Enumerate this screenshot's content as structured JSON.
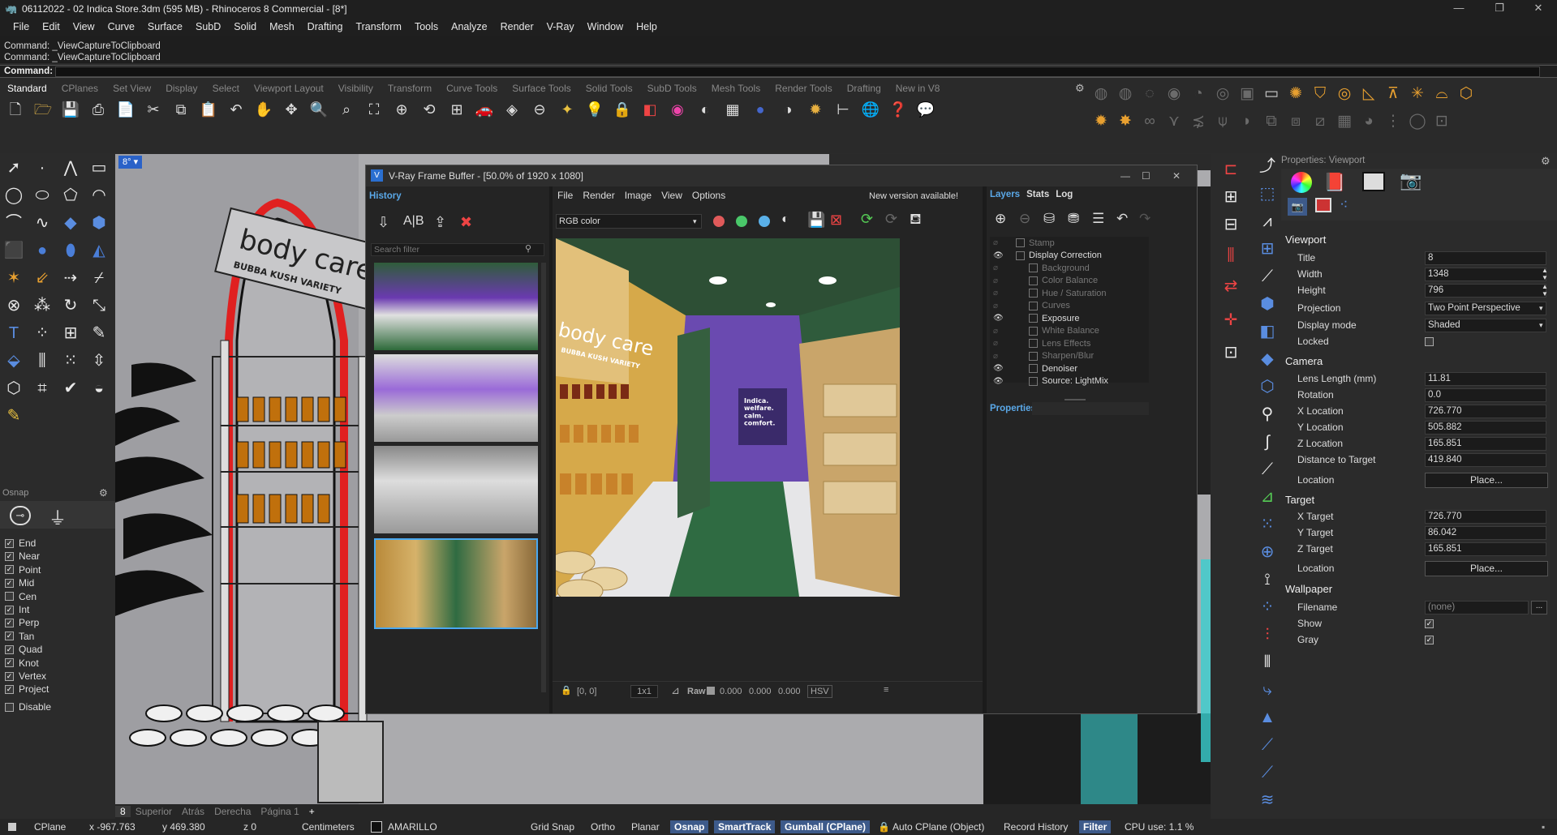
{
  "window": {
    "title": "06112022 - 02 Indica Store.3dm (595 MB) - Rhinoceros 8 Commercial - [8*]"
  },
  "menu": [
    "File",
    "Edit",
    "View",
    "Curve",
    "Surface",
    "SubD",
    "Solid",
    "Mesh",
    "Drafting",
    "Transform",
    "Tools",
    "Analyze",
    "Render",
    "V-Ray",
    "Window",
    "Help"
  ],
  "command_history": [
    "Command: _ViewCaptureToClipboard",
    "Command: _ViewCaptureToClipboard"
  ],
  "command_prompt": "Command:",
  "toolbar_tabs": [
    "Standard",
    "CPlanes",
    "Set View",
    "Display",
    "Select",
    "Viewport Layout",
    "Visibility",
    "Transform",
    "Curve Tools",
    "Surface Tools",
    "Solid Tools",
    "SubD Tools",
    "Mesh Tools",
    "Render Tools",
    "Drafting",
    "New in V8"
  ],
  "osnap": {
    "title": "Osnap",
    "items": [
      {
        "label": "End",
        "checked": true
      },
      {
        "label": "Near",
        "checked": true
      },
      {
        "label": "Point",
        "checked": true
      },
      {
        "label": "Mid",
        "checked": true
      },
      {
        "label": "Cen",
        "checked": false
      },
      {
        "label": "Int",
        "checked": true
      },
      {
        "label": "Perp",
        "checked": true
      },
      {
        "label": "Tan",
        "checked": true
      },
      {
        "label": "Quad",
        "checked": true
      },
      {
        "label": "Knot",
        "checked": true
      },
      {
        "label": "Vertex",
        "checked": true
      },
      {
        "label": "Project",
        "checked": true
      }
    ],
    "disable": "Disable"
  },
  "viewport": {
    "label": "8°",
    "sign_text": "body care",
    "sign_sub": "BUBBA KUSH VARIETY"
  },
  "viewport_tabs": [
    "8",
    "Superior",
    "Atrás",
    "Derecha",
    "Página 1",
    "+"
  ],
  "status": {
    "cplane": "CPlane",
    "x": "x -967.763",
    "y": "y 469.380",
    "z": "z 0",
    "units": "Centimeters",
    "layer": "AMARILLO",
    "grid_snap": "Grid Snap",
    "ortho": "Ortho",
    "planar": "Planar",
    "osnap": "Osnap",
    "smarttrack": "SmartTrack",
    "gumball": "Gumball (CPlane)",
    "autocplane": "Auto CPlane (Object)",
    "record": "Record History",
    "filter": "Filter",
    "cpu": "CPU use: 1.1 %"
  },
  "vfb": {
    "title": "V-Ray Frame Buffer - [50.0% of 1920 x 1080]",
    "history_label": "History",
    "search_placeholder": "Search filter",
    "menu": [
      "File",
      "Render",
      "Image",
      "View",
      "Options"
    ],
    "new_version": "New version available!",
    "channel": "RGB color",
    "tabs": [
      "Layers",
      "Stats",
      "Log"
    ],
    "layers": [
      {
        "label": "Stamp",
        "eye": false,
        "indent": 0
      },
      {
        "label": "Display Correction",
        "eye": true,
        "indent": 0
      },
      {
        "label": "Background",
        "eye": false,
        "indent": 1
      },
      {
        "label": "Color Balance",
        "eye": false,
        "indent": 1
      },
      {
        "label": "Hue / Saturation",
        "eye": false,
        "indent": 1
      },
      {
        "label": "Curves",
        "eye": false,
        "indent": 1
      },
      {
        "label": "Exposure",
        "eye": true,
        "indent": 1
      },
      {
        "label": "White Balance",
        "eye": false,
        "indent": 1
      },
      {
        "label": "Lens Effects",
        "eye": false,
        "indent": 1
      },
      {
        "label": "Sharpen/Blur",
        "eye": false,
        "indent": 1
      },
      {
        "label": "Denoiser",
        "eye": true,
        "indent": 1
      },
      {
        "label": "Source: LightMix",
        "eye": true,
        "indent": 1
      }
    ],
    "properties_label": "Properties",
    "footer": {
      "coords": "[0, 0]",
      "ratio": "1x1",
      "raw": "Raw",
      "r": "0.000",
      "g": "0.000",
      "b": "0.000",
      "mode": "HSV"
    },
    "render_text": {
      "sign": "body care",
      "sign_sub": "BUBBA KUSH VARIETY",
      "poster": "Indica.\nwelfare.\ncalm.\ncomfort."
    }
  },
  "properties": {
    "header": "Properties: Viewport",
    "viewport_section": "Viewport",
    "title_label": "Title",
    "title_value": "8",
    "width_label": "Width",
    "width_value": "1348",
    "height_label": "Height",
    "height_value": "796",
    "projection_label": "Projection",
    "projection_value": "Two Point Perspective",
    "display_label": "Display mode",
    "display_value": "Shaded",
    "locked_label": "Locked",
    "camera_section": "Camera",
    "lens_label": "Lens Length (mm)",
    "lens_value": "11.81",
    "rotation_label": "Rotation",
    "rotation_value": "0.0",
    "xloc_label": "X Location",
    "xloc_value": "726.770",
    "yloc_label": "Y Location",
    "yloc_value": "505.882",
    "zloc_label": "Z Location",
    "zloc_value": "165.851",
    "dist_label": "Distance to Target",
    "dist_value": "419.840",
    "location_label": "Location",
    "place": "Place...",
    "target_section": "Target",
    "xt_label": "X Target",
    "xt_value": "726.770",
    "yt_label": "Y Target",
    "yt_value": "86.042",
    "zt_label": "Z Target",
    "zt_value": "165.851",
    "tloc_label": "Location",
    "wallpaper_section": "Wallpaper",
    "filename_label": "Filename",
    "filename_value": "(none)",
    "show_label": "Show",
    "gray_label": "Gray"
  }
}
